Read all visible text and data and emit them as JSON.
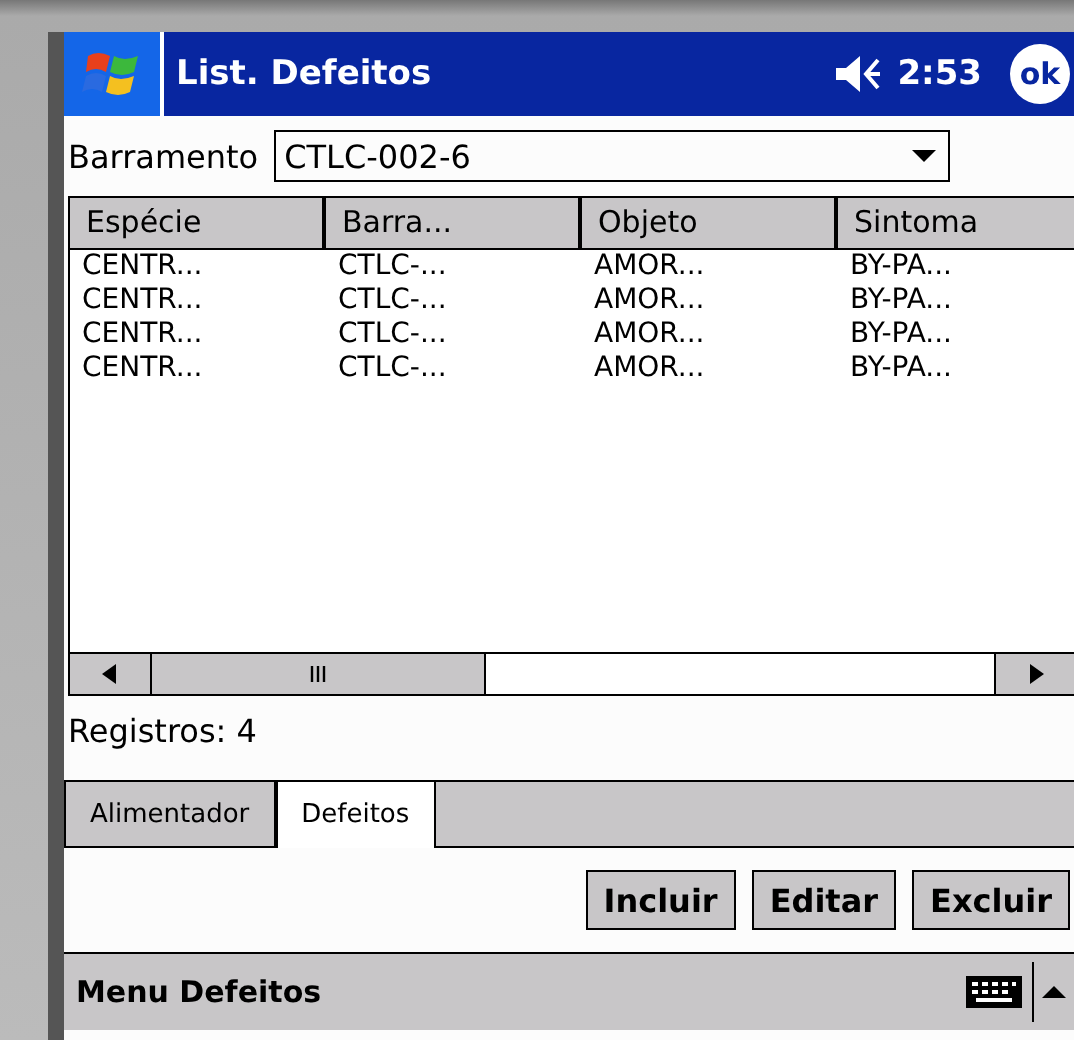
{
  "title_bar": {
    "title": "List. Defeitos",
    "time": "2:53",
    "ok": "ok"
  },
  "filter": {
    "label": "Barramento",
    "value": "CTLC-002-6"
  },
  "table": {
    "columns": [
      "Espécie",
      "Barra...",
      "Objeto",
      "Sintoma"
    ],
    "rows": [
      [
        "CENTR...",
        "CTLC-...",
        "AMOR...",
        "BY-PA..."
      ],
      [
        "CENTR...",
        "CTLC-...",
        "AMOR...",
        "BY-PA..."
      ],
      [
        "CENTR...",
        "CTLC-...",
        "AMOR...",
        "BY-PA..."
      ],
      [
        "CENTR...",
        "CTLC-...",
        "AMOR...",
        "BY-PA..."
      ]
    ]
  },
  "record_count": "Registros: 4",
  "tabs": [
    {
      "label": "Alimentador",
      "selected": false
    },
    {
      "label": "Defeitos",
      "selected": true
    }
  ],
  "buttons": [
    "Incluir",
    "Editar",
    "Excluir"
  ],
  "menu_bar": {
    "label": "Menu Defeitos"
  }
}
